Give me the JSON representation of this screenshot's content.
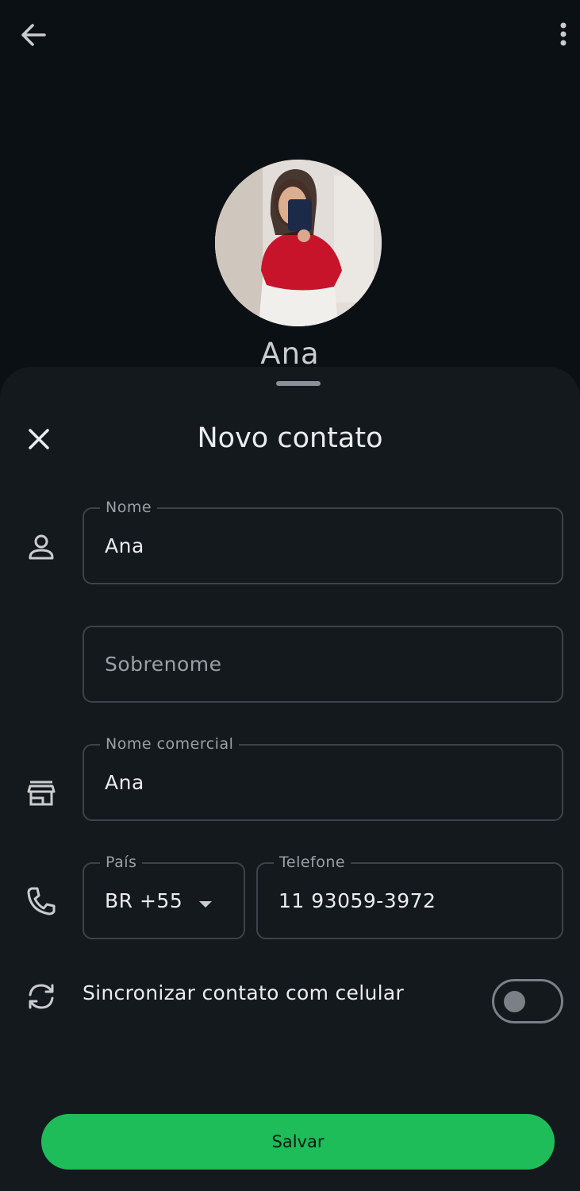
{
  "profile": {
    "name": "Ana"
  },
  "sheet": {
    "title": "Novo contato"
  },
  "form": {
    "first_name": {
      "label": "Nome",
      "value": "Ana"
    },
    "last_name": {
      "placeholder": "Sobrenome"
    },
    "business_name": {
      "label": "Nome comercial",
      "value": "Ana"
    },
    "country": {
      "label": "País",
      "value": "BR +55"
    },
    "phone": {
      "label": "Telefone",
      "value": "11 93059-3972"
    },
    "sync": {
      "label": "Sincronizar contato com celular",
      "enabled": false
    }
  },
  "actions": {
    "save_label": "Salvar"
  },
  "colors": {
    "accent": "#1fbc5a",
    "background": "#0b1014",
    "sheet": "#14191d"
  },
  "icons": [
    "back-arrow-icon",
    "more-vert-icon",
    "close-icon",
    "person-icon",
    "store-icon",
    "phone-icon",
    "sync-icon",
    "dropdown-arrow-icon"
  ]
}
